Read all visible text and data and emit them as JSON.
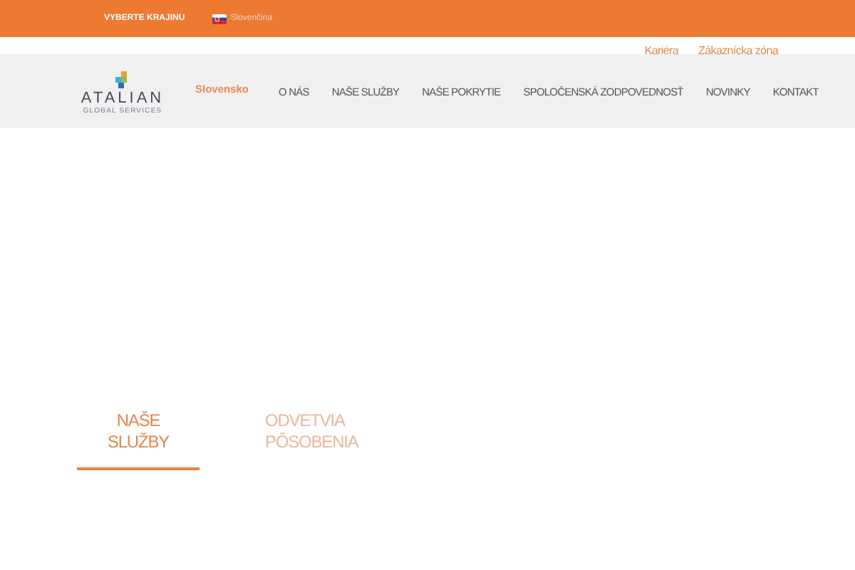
{
  "top_bar": {
    "country_label": "VYBERTE KRAJINU",
    "language": "Slovenčina"
  },
  "utility_links": [
    "Kariéra",
    "Zákaznícka zóna"
  ],
  "logo": {
    "name": "ATALIAN",
    "tagline": "GLOBAL SERVICES"
  },
  "country": "Slovensko",
  "nav": [
    {
      "label": "O NÁS"
    },
    {
      "label": "NAŠE SLUŽBY"
    },
    {
      "label": "NAŠE POKRYTIE"
    },
    {
      "label": "SPOLOČENSKÁ ZODPOVEDNOSŤ"
    },
    {
      "label": "NOVINKY"
    },
    {
      "label": "KONTAKT"
    }
  ],
  "tabs": [
    {
      "label": "NAŠE SLUŽBY",
      "selected": true
    },
    {
      "label": "ODVETVIA PÔSOBENIA",
      "selected": false
    }
  ]
}
